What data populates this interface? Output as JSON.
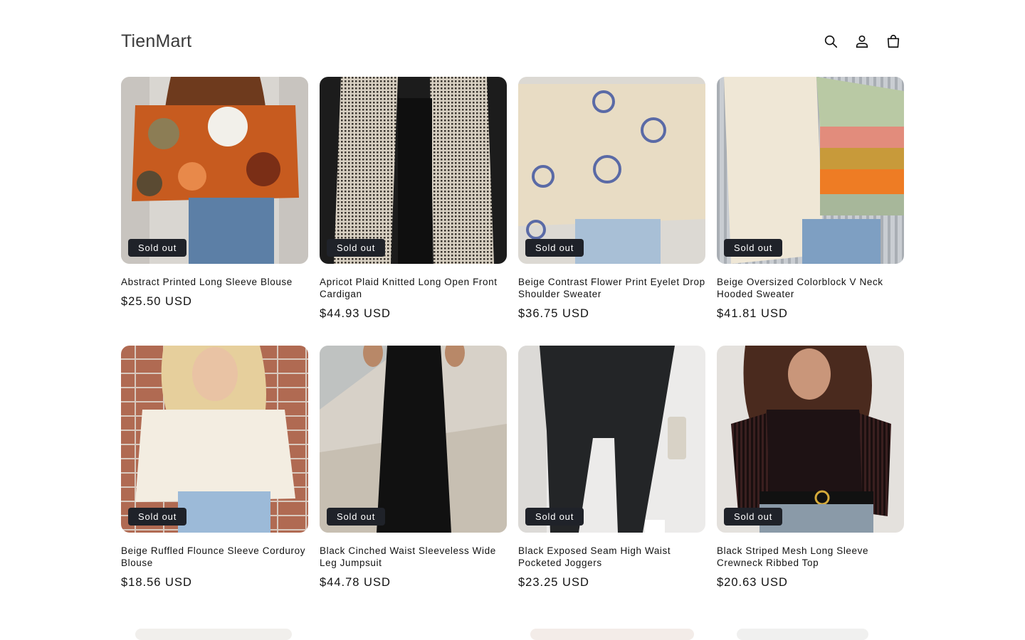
{
  "store": {
    "name": "TienMart"
  },
  "header_icons": [
    "search-icon",
    "account-icon",
    "cart-icon"
  ],
  "badge_text": "Sold out",
  "products": [
    {
      "title": "Abstract Printed Long Sleeve Blouse",
      "price": "$25.50 USD",
      "sold_out": true
    },
    {
      "title": "Apricot Plaid Knitted Long Open Front Cardigan",
      "price": "$44.93 USD",
      "sold_out": true
    },
    {
      "title": "Beige Contrast Flower Print Eyelet Drop Shoulder Sweater",
      "price": "$36.75 USD",
      "sold_out": true
    },
    {
      "title": "Beige Oversized Colorblock V Neck Hooded Sweater",
      "price": "$41.81 USD",
      "sold_out": true
    },
    {
      "title": "Beige Ruffled Flounce Sleeve Corduroy Blouse",
      "price": "$18.56 USD",
      "sold_out": true
    },
    {
      "title": "Black Cinched Waist Sleeveless Wide Leg Jumpsuit",
      "price": "$44.78 USD",
      "sold_out": true
    },
    {
      "title": "Black Exposed Seam High Waist Pocketed Joggers",
      "price": "$23.25 USD",
      "sold_out": true
    },
    {
      "title": "Black Striped Mesh Long Sleeve Crewneck Ribbed Top",
      "price": "$20.63 USD",
      "sold_out": true
    }
  ],
  "colors": {
    "badge_bg": "#1f2229",
    "text": "#121212"
  }
}
